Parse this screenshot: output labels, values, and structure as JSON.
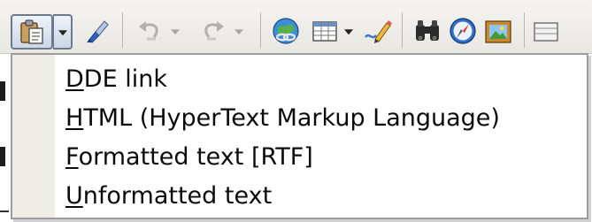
{
  "toolbar": {
    "icons": [
      "paste-icon",
      "chevron-down-icon",
      "clone-formatting-brush-icon",
      "undo-icon",
      "redo-icon",
      "hyperlink-icon",
      "table-icon",
      "show-draw-functions-icon",
      "find-replace-binoculars-icon",
      "navigator-compass-icon",
      "gallery-icon"
    ]
  },
  "paste_special_menu": {
    "items": [
      {
        "mnemonic": "D",
        "rest": "DE link"
      },
      {
        "mnemonic": "H",
        "rest": "TML (HyperText Markup Language)"
      },
      {
        "mnemonic": "F",
        "rest": "ormatted text [RTF]"
      },
      {
        "mnemonic": "U",
        "rest": "nformatted text"
      }
    ]
  }
}
